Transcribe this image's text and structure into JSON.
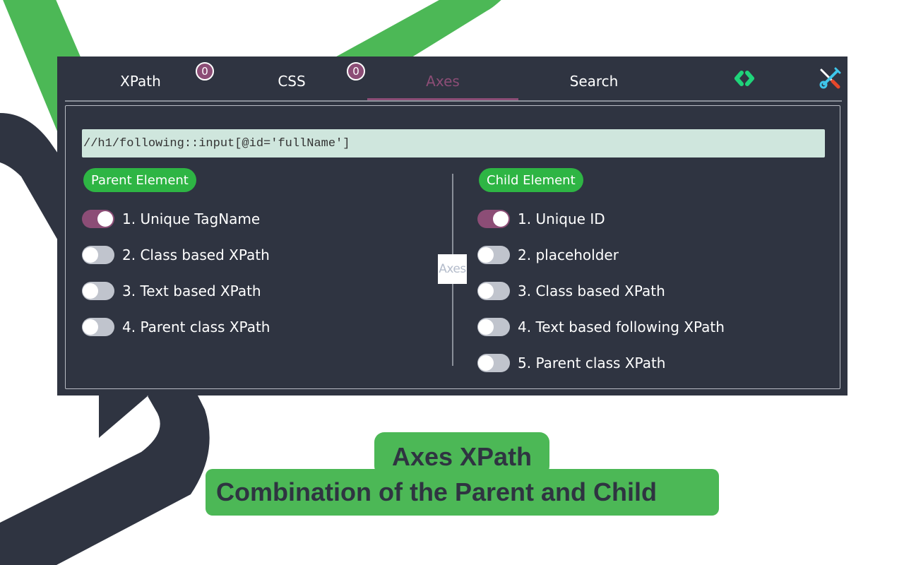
{
  "colors": {
    "panel_bg": "#2f3441",
    "accent_purple": "#8c4d76",
    "pill_green": "#2eb544",
    "brand_green": "#4cb856",
    "input_bg": "#cfe6dd",
    "toggle_off": "#c0c4cd",
    "code_icon_green": "#1fd47a",
    "tools_icon_blue": "#3fc6ea",
    "tools_icon_red": "#e5482b"
  },
  "tabs": [
    {
      "label": "XPath",
      "badge": "0",
      "active": false
    },
    {
      "label": "CSS",
      "badge": "0",
      "active": false
    },
    {
      "label": "Axes",
      "active": true
    },
    {
      "label": "Search",
      "active": false
    }
  ],
  "toolbar": {
    "code_icon": "code-brackets-icon",
    "tools_icon": "screwdriver-wrench-icon"
  },
  "xpath_input": {
    "value": "//h1/following::input[@id='fullName']"
  },
  "parent": {
    "title": "Parent Element",
    "options": [
      {
        "label": "1. Unique TagName",
        "checked": true
      },
      {
        "label": "2. Class based XPath",
        "checked": false
      },
      {
        "label": "3. Text based XPath",
        "checked": false
      },
      {
        "label": "4. Parent class XPath",
        "checked": false
      }
    ]
  },
  "divider_label": "Axes",
  "child": {
    "title": "Child Element",
    "options": [
      {
        "label": "1. Unique ID",
        "checked": true
      },
      {
        "label": "2. placeholder",
        "checked": false
      },
      {
        "label": "3. Class based XPath",
        "checked": false
      },
      {
        "label": "4. Text based following XPath",
        "checked": false
      },
      {
        "label": "5. Parent class XPath",
        "checked": false
      }
    ]
  },
  "caption": {
    "title": "Axes XPath",
    "subtitle": "Combination of the Parent and Child"
  }
}
